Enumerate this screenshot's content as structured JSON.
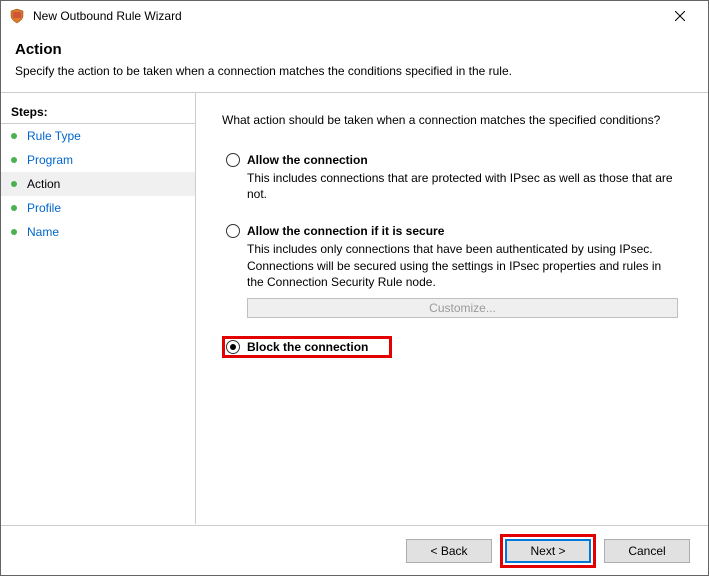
{
  "window": {
    "title": "New Outbound Rule Wizard"
  },
  "header": {
    "title": "Action",
    "subtitle": "Specify the action to be taken when a connection matches the conditions specified in the rule."
  },
  "sidebar": {
    "label": "Steps:",
    "items": [
      {
        "label": "Rule Type",
        "active": false
      },
      {
        "label": "Program",
        "active": false
      },
      {
        "label": "Action",
        "active": true
      },
      {
        "label": "Profile",
        "active": false
      },
      {
        "label": "Name",
        "active": false
      }
    ]
  },
  "main": {
    "prompt": "What action should be taken when a connection matches the specified conditions?",
    "options": [
      {
        "title": "Allow the connection",
        "desc": "This includes connections that are protected with IPsec as well as those that are not.",
        "selected": false
      },
      {
        "title": "Allow the connection if it is secure",
        "desc": "This includes only connections that have been authenticated by using IPsec. Connections will be secured using the settings in IPsec properties and rules in the Connection Security Rule node.",
        "selected": false,
        "customize": "Customize..."
      },
      {
        "title": "Block the connection",
        "desc": "",
        "selected": true
      }
    ]
  },
  "footer": {
    "back": "< Back",
    "next": "Next >",
    "cancel": "Cancel"
  }
}
